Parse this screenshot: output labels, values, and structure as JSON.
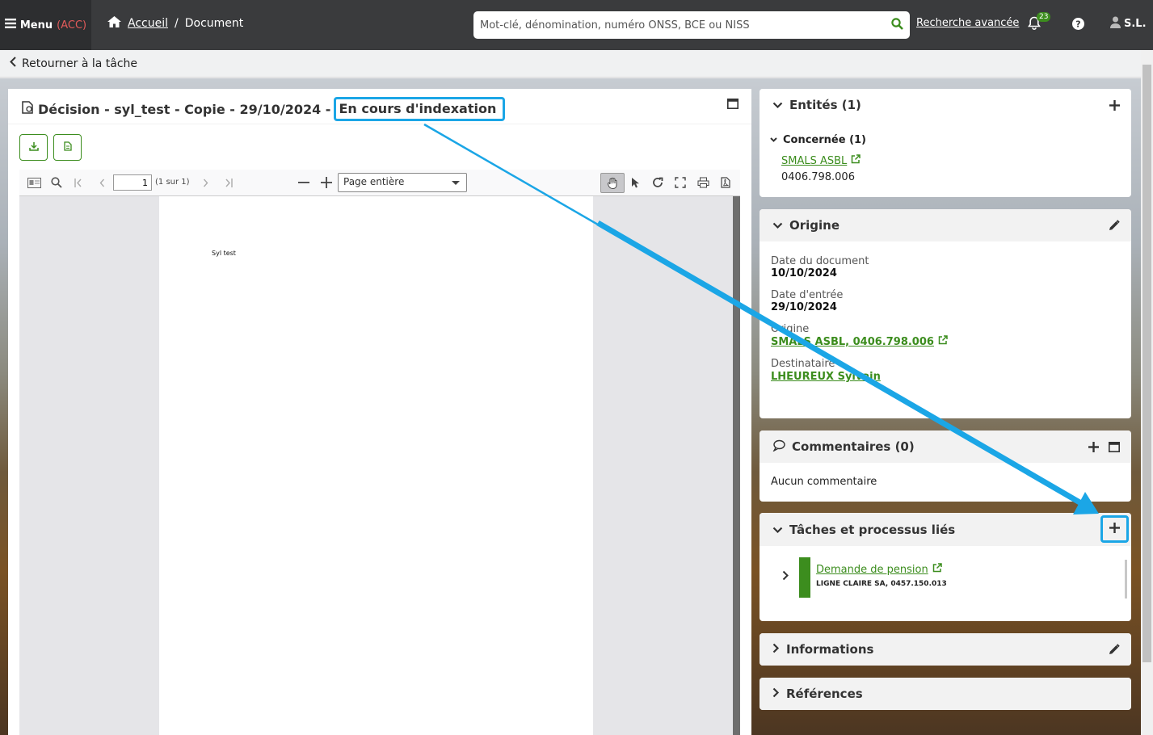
{
  "header": {
    "menu_label": "Menu",
    "menu_env": "(ACC)",
    "breadcrumb_home": "Accueil",
    "breadcrumb_sep": "/",
    "breadcrumb_current": "Document",
    "search_placeholder": "Mot-clé, dénomination, numéro ONSS, BCE ou NISS",
    "advanced_search": "Recherche avancée",
    "notifications_count": "23",
    "user_initials": "S.L."
  },
  "subbar": {
    "back_label": "Retourner à la tâche"
  },
  "document": {
    "title": "Décision - syl_test - Copie - 29/10/2024 -",
    "status": "En cours d'indexation",
    "viewer": {
      "page_input": "1",
      "page_count": "(1 sur 1)",
      "zoom": "Page entière",
      "page_text": "Syl test"
    }
  },
  "entities": {
    "title": "Entités (1)",
    "group_title": "Concernée (1)",
    "entity_name": "SMALS ASBL",
    "entity_number": "0406.798.006"
  },
  "origine": {
    "title": "Origine",
    "date_doc_label": "Date du document",
    "date_doc": "10/10/2024",
    "date_entry_label": "Date d'entrée",
    "date_entry": "29/10/2024",
    "origin_label": "Origine",
    "origin_value": "SMALS ASBL, 0406.798.006",
    "recipient_label": "Destinataire",
    "recipient_value": "LHEUREUX Sylvain"
  },
  "comments": {
    "title": "Commentaires (0)",
    "empty": "Aucun commentaire"
  },
  "tasks": {
    "title": "Tâches et processus liés",
    "item_title": "Demande de pension",
    "item_sub": "LIGNE CLAIRE SA, 0457.150.013",
    "item_color": "#3c8d1e"
  },
  "informations": {
    "title": "Informations"
  },
  "references": {
    "title": "Références"
  },
  "colors": {
    "accent_green": "#3c8d1e",
    "highlight_blue": "#1ba6e6"
  }
}
